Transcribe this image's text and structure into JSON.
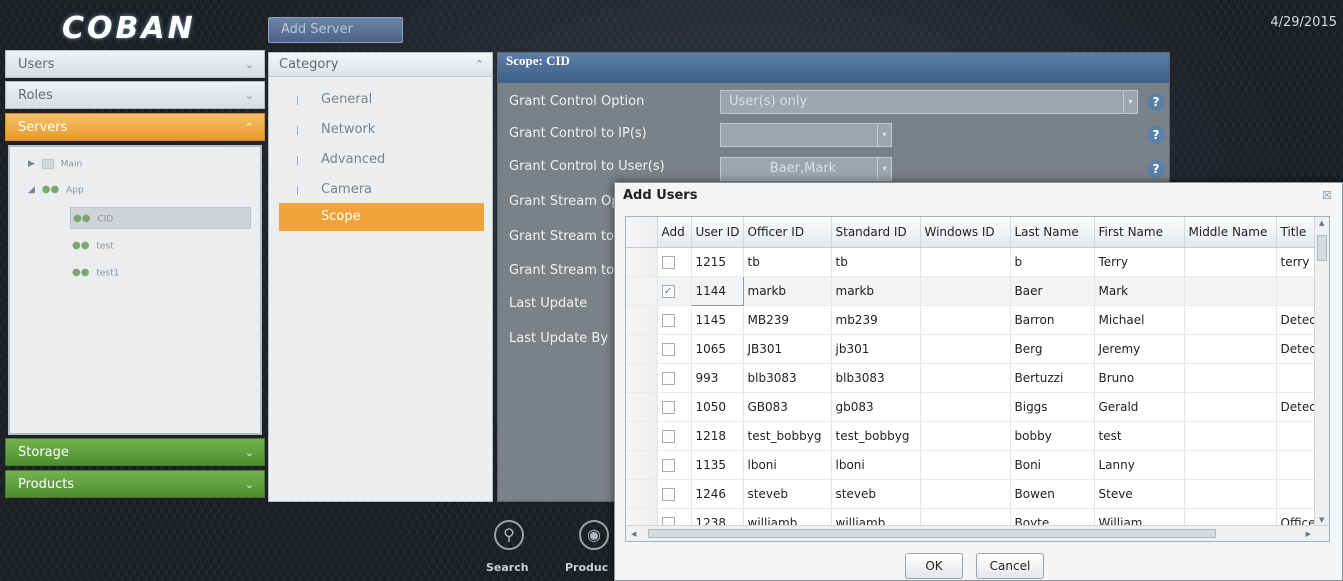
{
  "header": {
    "logo_text": "COBAN",
    "add_server_label": "Add Server",
    "date": "4/29/2015"
  },
  "accordion": {
    "users": "Users",
    "roles": "Roles",
    "servers": "Servers",
    "storage": "Storage",
    "products": "Products"
  },
  "tree": {
    "main": "Main",
    "app": "App",
    "children": [
      "CID",
      "test",
      "test1"
    ]
  },
  "category": {
    "header": "Category",
    "items": [
      "General",
      "Network",
      "Advanced",
      "Camera",
      "Scope"
    ],
    "active": "Scope"
  },
  "scope": {
    "title": "Scope: CID",
    "labels": [
      "Grant Control Option",
      "Grant Control to IP(s)",
      "Grant Control to User(s)",
      "Grant Stream Op",
      "Grant Stream to",
      "Grant Stream to",
      "Last Update",
      "Last Update By"
    ],
    "grant_control_option_value": "User(s) only",
    "grant_control_ip_value": "",
    "grant_control_user_value": "Baer,Mark",
    "help_glyph": "?"
  },
  "dock": {
    "search_label": "Search",
    "products_label": "Produc"
  },
  "modal": {
    "title": "Add Users",
    "close_glyph": "☒",
    "columns": [
      "Add",
      "User ID",
      "Officer ID",
      "Standard ID",
      "Windows ID",
      "Last Name",
      "First Name",
      "Middle Name",
      "Title"
    ],
    "rows": [
      {
        "checked": false,
        "user_id": "1215",
        "officer_id": "tb",
        "standard_id": "tb",
        "windows_id": "",
        "last_name": "b",
        "first_name": "Terry",
        "middle_name": "",
        "title": "terry"
      },
      {
        "checked": true,
        "user_id": "1144",
        "officer_id": "markb",
        "standard_id": "markb",
        "windows_id": "",
        "last_name": "Baer",
        "first_name": "Mark",
        "middle_name": "",
        "title": ""
      },
      {
        "checked": false,
        "user_id": "1145",
        "officer_id": "MB239",
        "standard_id": "mb239",
        "windows_id": "",
        "last_name": "Barron",
        "first_name": "Michael",
        "middle_name": "",
        "title": "Detec"
      },
      {
        "checked": false,
        "user_id": "1065",
        "officer_id": "JB301",
        "standard_id": "jb301",
        "windows_id": "",
        "last_name": "Berg",
        "first_name": "Jeremy",
        "middle_name": "",
        "title": "Detec"
      },
      {
        "checked": false,
        "user_id": "993",
        "officer_id": "blb3083",
        "standard_id": "blb3083",
        "windows_id": "",
        "last_name": "Bertuzzi",
        "first_name": "Bruno",
        "middle_name": "",
        "title": ""
      },
      {
        "checked": false,
        "user_id": "1050",
        "officer_id": "GB083",
        "standard_id": "gb083",
        "windows_id": "",
        "last_name": "Biggs",
        "first_name": "Gerald",
        "middle_name": "",
        "title": "Detec"
      },
      {
        "checked": false,
        "user_id": "1218",
        "officer_id": "test_bobbyg",
        "standard_id": "test_bobbyg",
        "windows_id": "",
        "last_name": "bobby",
        "first_name": "test",
        "middle_name": "",
        "title": ""
      },
      {
        "checked": false,
        "user_id": "1135",
        "officer_id": "lboni",
        "standard_id": "lboni",
        "windows_id": "",
        "last_name": "Boni",
        "first_name": "Lanny",
        "middle_name": "",
        "title": ""
      },
      {
        "checked": false,
        "user_id": "1246",
        "officer_id": "steveb",
        "standard_id": "steveb",
        "windows_id": "",
        "last_name": "Bowen",
        "first_name": "Steve",
        "middle_name": "",
        "title": ""
      },
      {
        "checked": false,
        "user_id": "1238",
        "officer_id": "williamb",
        "standard_id": "williamb",
        "windows_id": "",
        "last_name": "Boyte",
        "first_name": "William",
        "middle_name": "",
        "title": "Office"
      }
    ],
    "ok_label": "OK",
    "cancel_label": "Cancel"
  },
  "colors": {
    "accent_orange": "#f0a33a",
    "accent_green": "#5c9b3a",
    "scope_header_blue": "#4f6f99"
  }
}
